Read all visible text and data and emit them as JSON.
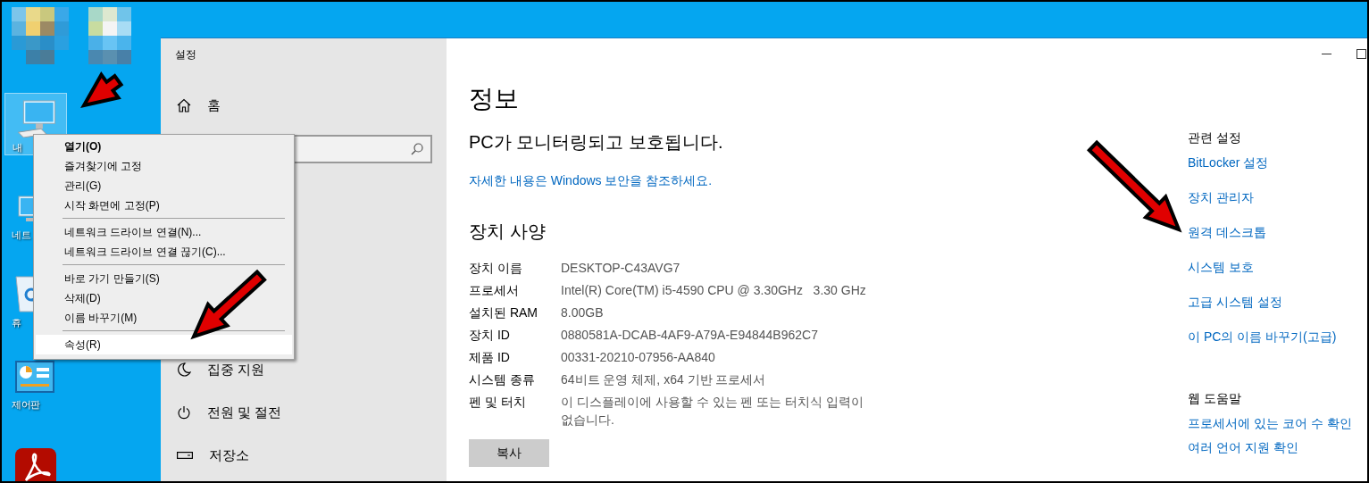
{
  "desktop": {
    "icons": [
      {
        "kind": "computer",
        "label": "내",
        "selected": true
      },
      {
        "kind": "network",
        "label": "네트",
        "selected": false
      },
      {
        "kind": "recycle-bin",
        "label": "휴",
        "selected": false
      },
      {
        "kind": "control-panel",
        "label": "제어판",
        "selected": false
      },
      {
        "kind": "pdf",
        "selected": false
      }
    ]
  },
  "settings_window": {
    "title": "설정",
    "nav": {
      "home": "홈",
      "items": [
        {
          "kind": "focus",
          "label": "집중 지원"
        },
        {
          "kind": "power",
          "label": "전원 및 절전"
        },
        {
          "kind": "storage",
          "label": "저장소"
        }
      ]
    },
    "heading": "정보",
    "security_status": "PC가 모니터링되고 보호됩니다.",
    "security_link": "자세한 내용은 Windows 보안을 참조하세요.",
    "specs_heading": "장치 사양",
    "specs": [
      {
        "label": "장치 이름",
        "value": "DESKTOP-C43AVG7"
      },
      {
        "label": "프로세서",
        "value": "Intel(R) Core(TM) i5-4590 CPU @ 3.30GHz   3.30 GHz"
      },
      {
        "label": "설치된 RAM",
        "value": "8.00GB"
      },
      {
        "label": "장치 ID",
        "value": "0880581A-DCAB-4AF9-A79A-E94844B962C7"
      },
      {
        "label": "제품 ID",
        "value": "00331-20210-07956-AA840"
      },
      {
        "label": "시스템 종류",
        "value": "64비트 운영 체제, x64 기반 프로세서"
      },
      {
        "label": "펜 및 터치",
        "value": "이 디스플레이에 사용할 수 있는 펜 또는 터치식 입력이 없습니다."
      }
    ],
    "copy_button": "복사",
    "related_heading": "관련 설정",
    "related_links": [
      "BitLocker 설정",
      "장치 관리자",
      "원격 데스크톱",
      "시스템 보호",
      "고급 시스템 설정",
      "이 PC의 이름 바꾸기(고급)"
    ],
    "help_heading": "웹 도움말",
    "help_links": [
      "프로세서에 있는 코어 수 확인",
      "여러 언어 지원 확인"
    ]
  },
  "context_menu": {
    "groups": [
      [
        {
          "label": "열기(O)",
          "default": true,
          "selected": false
        },
        {
          "label": "즐겨찾기에 고정",
          "default": false,
          "selected": false
        },
        {
          "label": "관리(G)",
          "default": false,
          "selected": false
        },
        {
          "label": "시작 화면에 고정(P)",
          "default": false,
          "selected": false
        }
      ],
      [
        {
          "label": "네트워크 드라이브 연결(N)...",
          "default": false,
          "selected": false
        },
        {
          "label": "네트워크 드라이브 연결 끊기(C)...",
          "default": false,
          "selected": false
        }
      ],
      [
        {
          "label": "바로 가기 만들기(S)",
          "default": false,
          "selected": false
        },
        {
          "label": "삭제(D)",
          "default": false,
          "selected": false
        },
        {
          "label": "이름 바꾸기(M)",
          "default": false,
          "selected": false
        }
      ],
      [
        {
          "label": "속성(R)",
          "default": false,
          "selected": true
        }
      ]
    ]
  }
}
